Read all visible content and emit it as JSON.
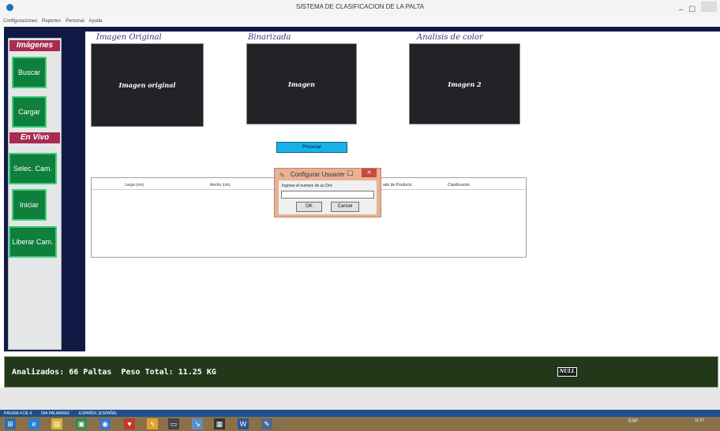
{
  "window": {
    "title": "SISTEMA DE CLASIFICACION DE LA PALTA"
  },
  "menu": [
    "Configuraciones",
    "Reportes",
    "Personal",
    "Ayuda"
  ],
  "sidebar": {
    "section_images": "Imágenes",
    "btn_buscar": "Buscar",
    "btn_cargar": "Cargar",
    "section_live": "En Vivo",
    "btn_selec_cam": "Selec. Cam.",
    "btn_iniciar": "Iniciar",
    "btn_liberar_cam": "Liberar Cam."
  },
  "panels": [
    {
      "title": "Imagen Original",
      "content": "Imagen original"
    },
    {
      "title": "Binarizada",
      "content": "Imagen"
    },
    {
      "title": "Analisis de color",
      "content": "Imagen 2"
    }
  ],
  "process_button": "Procesar",
  "table": {
    "columns": [
      "Largo (cm)",
      "Ancho (cm)",
      "ado de Producto",
      "Clasificación"
    ]
  },
  "dialog": {
    "title": "Configurar Usuario",
    "prompt": "Ingrese el numero de su Dni:",
    "input_value": "",
    "ok": "OK",
    "cancel": "Cancel"
  },
  "status": {
    "text": "Analizados: 66 Paltas  Peso Total: 11.25 KG",
    "badge": "NULL"
  },
  "word_status": {
    "page": "PÁGINA 4 DE 4",
    "words": "594 PALABRAS",
    "language": "ESPAÑOL (ESPAÑA)"
  },
  "tray": {
    "lang": "ESP",
    "time": "11:07"
  },
  "colors": {
    "navy": "#0f1b45",
    "sidebar_header": "#a82c50",
    "sidebar_button": "#0f7f3c",
    "status_bar": "#213819",
    "process_button": "#17b3e8",
    "dialog_frame": "#e9b093",
    "taskbar": "#8a7049"
  }
}
